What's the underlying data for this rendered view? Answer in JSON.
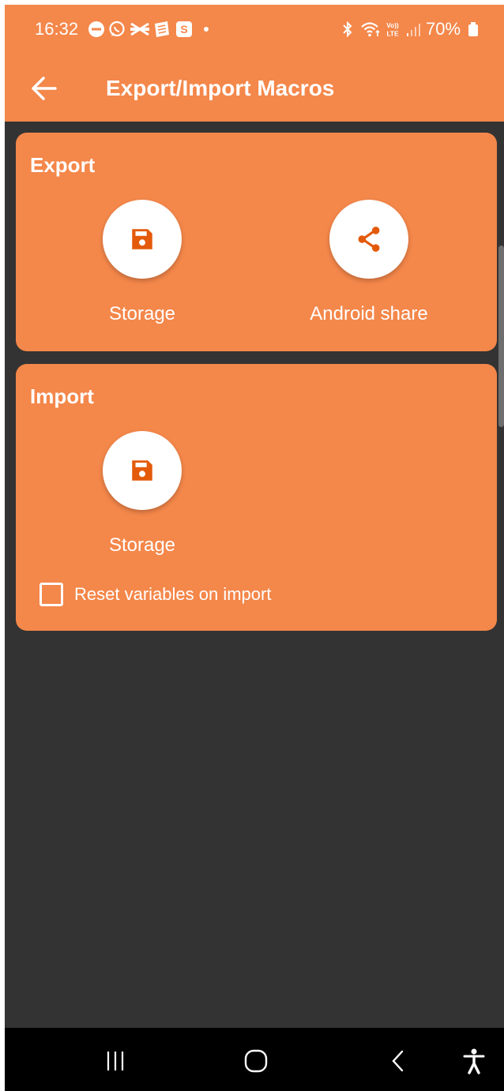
{
  "status_bar": {
    "time": "16:32",
    "battery": "70%",
    "icons": [
      "do-not-disturb-icon",
      "whatsapp-icon",
      "app-notification-icon",
      "news-icon",
      "s-app-icon",
      "more-notifications-dot-icon",
      "bluetooth-icon",
      "wifi-icon",
      "volte-icon",
      "signal-icon",
      "battery-icon"
    ]
  },
  "toolbar": {
    "title": "Export/Import Macros",
    "back_icon": "back-arrow-icon"
  },
  "export_section": {
    "title": "Export",
    "actions": [
      {
        "label": "Storage",
        "icon": "floppy-disk-icon"
      },
      {
        "label": "Android share",
        "icon": "share-icon"
      }
    ]
  },
  "import_section": {
    "title": "Import",
    "actions": [
      {
        "label": "Storage",
        "icon": "floppy-disk-icon"
      }
    ],
    "reset_variables": {
      "label": "Reset variables on import",
      "checked": false
    }
  },
  "nav_bar": {
    "buttons": [
      "recent-apps-icon",
      "home-icon",
      "back-icon",
      "accessibility-icon"
    ]
  },
  "colors": {
    "accent": "#F4874A",
    "icon_color": "#E35A0A",
    "background": "#333333",
    "nav_background": "#000000"
  }
}
